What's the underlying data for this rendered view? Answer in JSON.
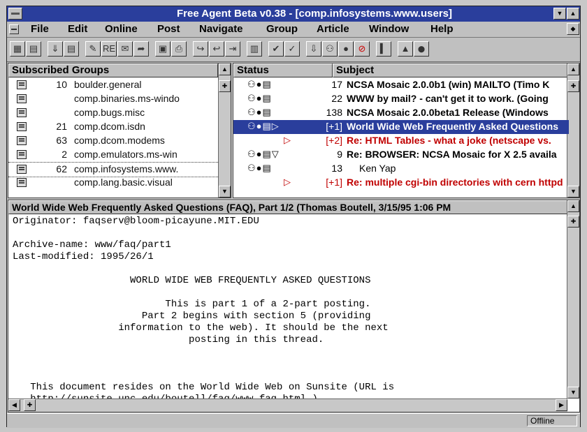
{
  "window": {
    "title": "Free Agent Beta v0.38 - [comp.infosystems.www.users]"
  },
  "menu": [
    {
      "label": "File"
    },
    {
      "label": "Edit"
    },
    {
      "label": "Online"
    },
    {
      "label": "Post"
    },
    {
      "label": "Navigate"
    },
    {
      "label": "Group"
    },
    {
      "label": "Article"
    },
    {
      "label": "Window"
    },
    {
      "label": "Help"
    }
  ],
  "toolbar_icons": [
    "get-new-headers-icon",
    "get-new-groups-icon",
    "get-article-icon",
    "get-marked-icon",
    "post-article-icon",
    "reply-icon",
    "reply-email-icon",
    "forward-icon",
    "save-icon",
    "print-icon",
    "next-icon",
    "previous-icon",
    "next-unread-icon",
    "find-icon",
    "mark-read-icon",
    "watch-icon",
    "keep-icon",
    "ignore-icon",
    "delete-icon",
    "bookmark-icon",
    "tower-icon",
    "stop-icon"
  ],
  "groups": {
    "header": "Subscribed Groups",
    "rows": [
      {
        "count": "10",
        "name": "boulder.general"
      },
      {
        "count": "",
        "name": "comp.binaries.ms-windo"
      },
      {
        "count": "",
        "name": "comp.bugs.misc"
      },
      {
        "count": "21",
        "name": "comp.dcom.isdn"
      },
      {
        "count": "63",
        "name": "comp.dcom.modems"
      },
      {
        "count": "2",
        "name": "comp.emulators.ms-win"
      },
      {
        "count": "62",
        "name": "comp.infosystems.www."
      },
      {
        "count": "",
        "name": "comp.lang.basic.visual"
      }
    ]
  },
  "articles": {
    "header_status": "Status",
    "header_subject": "Subject",
    "rows": [
      {
        "icons": "⚇●▤",
        "num": "17",
        "subject": "NCSA Mosaic 2.0.0b1 (win) MAILTO  (Timo K"
      },
      {
        "icons": "⚇●▤",
        "num": "22",
        "subject": "WWW by mail? - can't get it to work.  (Going"
      },
      {
        "icons": "⚇●▤",
        "num": "138",
        "subject": "NCSA Mosaic 2.0.0beta1 Release  (Windows"
      },
      {
        "icons": "⚇●▤▷",
        "num": "[+1]",
        "subject": "World Wide Web Frequently Asked Questions"
      },
      {
        "icons": "▷",
        "num": "[+2]",
        "subject": "Re: HTML Tables - what a joke (netscape vs."
      },
      {
        "icons": "⚇●▤▽",
        "num": "9",
        "subject": "Re: BROWSER: NCSA Mosaic for X 2.5 availa"
      },
      {
        "icons": "⚇●▤",
        "num": "13",
        "subject": "Ken Yap"
      },
      {
        "icons": "▷",
        "num": "[+1]",
        "subject": "Re: multiple cgi-bin directories with cern httpd"
      }
    ]
  },
  "message": {
    "title": "World Wide Web Frequently Asked Questions (FAQ), Part 1/2 (Thomas Boutell, 3/15/95 1:06 PM",
    "body": "Originator: faqserv@bloom-picayune.MIT.EDU\n\nArchive-name: www/faq/part1\nLast-modified: 1995/26/1\n\n                    WORLD WIDE WEB FREQUENTLY ASKED QUESTIONS\n\n                          This is part 1 of a 2-part posting.\n                      Part 2 begins with section 5 (providing\n                  information to the web). It should be the next\n                              posting in this thread.\n\n\n\n   This document resides on the World Wide Web on Sunsite (URL is\n   http://sunsite.unc.edu/boutell/faq/www_faq.html )."
  },
  "statusbar": {
    "mode": "Offline"
  },
  "colors": {
    "titlebar": "#2a3e9c",
    "selection": "#2a3e9c",
    "red_text": "#c00000"
  }
}
